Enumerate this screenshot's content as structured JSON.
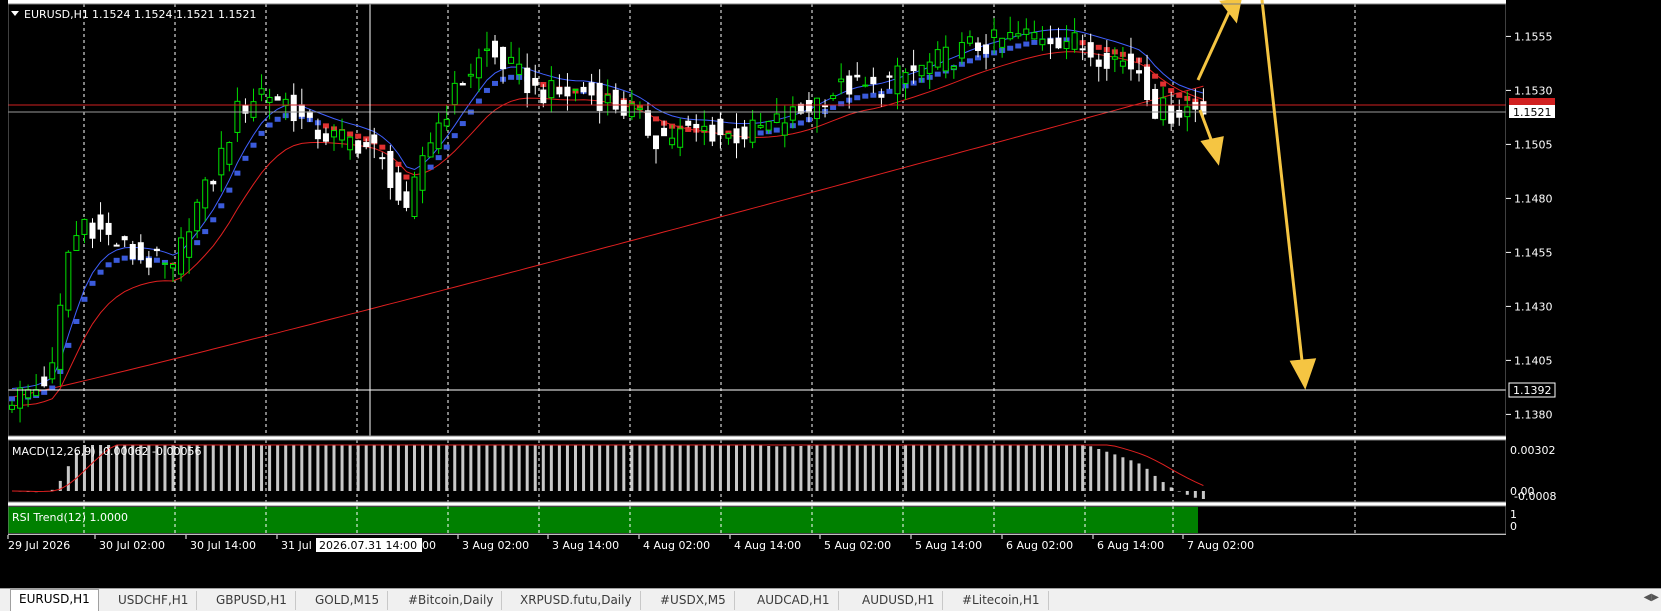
{
  "chart_header": {
    "symbol": "EURUSD,H1",
    "ohlc": "1.1524 1.1524 1.1521 1.1521"
  },
  "price_axis": {
    "ticks": [
      "1.1555",
      "1.1530",
      "1.1505",
      "1.1480",
      "1.1455",
      "1.1430",
      "1.1405",
      "1.1380"
    ],
    "current_price": "1.1521",
    "crosshair_price": "1.1392"
  },
  "macd": {
    "label": "MACD(12,26,9) -0.00062 -0.00056",
    "ticks": [
      "0.00302",
      "0.00",
      "-0.0008"
    ]
  },
  "rsi_trend": {
    "label": "RSI Trend(12) 1.0000",
    "ticks": [
      "1",
      "0"
    ]
  },
  "time_axis": {
    "labels": [
      "29 Jul 2026",
      "30 Jul 02:00",
      "30 Jul 14:00",
      "31 Jul",
      "3 Aug 02:00",
      "3 Aug 14:00",
      "4 Aug 02:00",
      "4 Aug 14:00",
      "5 Aug 02:00",
      "5 Aug 14:00",
      "6 Aug 02:00",
      "6 Aug 14:00",
      "7 Aug 02:00"
    ],
    "crosshair_time": "2026.07.31 14:00",
    "crosshair_suffix": "00"
  },
  "tabs": [
    "EURUSD,H1",
    "USDCHF,H1",
    "GBPUSD,H1",
    "GOLD,M15",
    "#Bitcoin,Daily",
    "XRPUSD.futu,Daily",
    "#USDX,M5",
    "AUDCAD,H1",
    "AUDUSD,H1",
    "#Litecoin,H1"
  ],
  "colors": {
    "background": "#000000",
    "bull_candle": "#00e000",
    "bear_candle": "#ffffff",
    "blue_band": "#3b5bdb",
    "red_band": "#e03131",
    "ma_line": "#e02020",
    "macd_hist": "#c8c8c8",
    "macd_signal": "#e02020",
    "rsi_fill": "#008000",
    "arrow": "#f5c542"
  },
  "chart_data": {
    "type": "candlestick",
    "symbol": "EURUSD",
    "timeframe": "H1",
    "ylim": [
      1.137,
      1.157
    ],
    "last_price": 1.1521,
    "close_path": [
      [
        0,
        1.1388
      ],
      [
        3,
        1.1392
      ],
      [
        5,
        1.14
      ],
      [
        7,
        1.1455
      ],
      [
        9,
        1.147
      ],
      [
        12,
        1.1462
      ],
      [
        15,
        1.1454
      ],
      [
        18,
        1.145
      ],
      [
        20,
        1.1445
      ],
      [
        22,
        1.147
      ],
      [
        25,
        1.149
      ],
      [
        28,
        1.152
      ],
      [
        31,
        1.153
      ],
      [
        34,
        1.1525
      ],
      [
        37,
        1.1512
      ],
      [
        40,
        1.1508
      ],
      [
        43,
        1.1506
      ],
      [
        45,
        1.1502
      ],
      [
        47,
        1.149
      ],
      [
        49,
        1.147
      ],
      [
        51,
        1.15
      ],
      [
        53,
        1.1515
      ],
      [
        56,
        1.1535
      ],
      [
        59,
        1.1548
      ],
      [
        62,
        1.154
      ],
      [
        65,
        1.153
      ],
      [
        68,
        1.1528
      ],
      [
        71,
        1.153
      ],
      [
        74,
        1.1525
      ],
      [
        77,
        1.152
      ],
      [
        80,
        1.1508
      ],
      [
        83,
        1.151
      ],
      [
        86,
        1.1512
      ],
      [
        89,
        1.1509
      ],
      [
        92,
        1.1511
      ],
      [
        95,
        1.1515
      ],
      [
        98,
        1.152
      ],
      [
        101,
        1.1528
      ],
      [
        104,
        1.1532
      ],
      [
        107,
        1.153
      ],
      [
        110,
        1.1536
      ],
      [
        113,
        1.154
      ],
      [
        116,
        1.1545
      ],
      [
        119,
        1.155
      ],
      [
        122,
        1.1552
      ],
      [
        125,
        1.1555
      ],
      [
        128,
        1.1556
      ],
      [
        131,
        1.1554
      ],
      [
        134,
        1.1548
      ],
      [
        137,
        1.1545
      ],
      [
        140,
        1.154
      ],
      [
        142,
        1.1522
      ],
      [
        144,
        1.152
      ],
      [
        146,
        1.1522
      ],
      [
        148,
        1.1521
      ]
    ]
  }
}
